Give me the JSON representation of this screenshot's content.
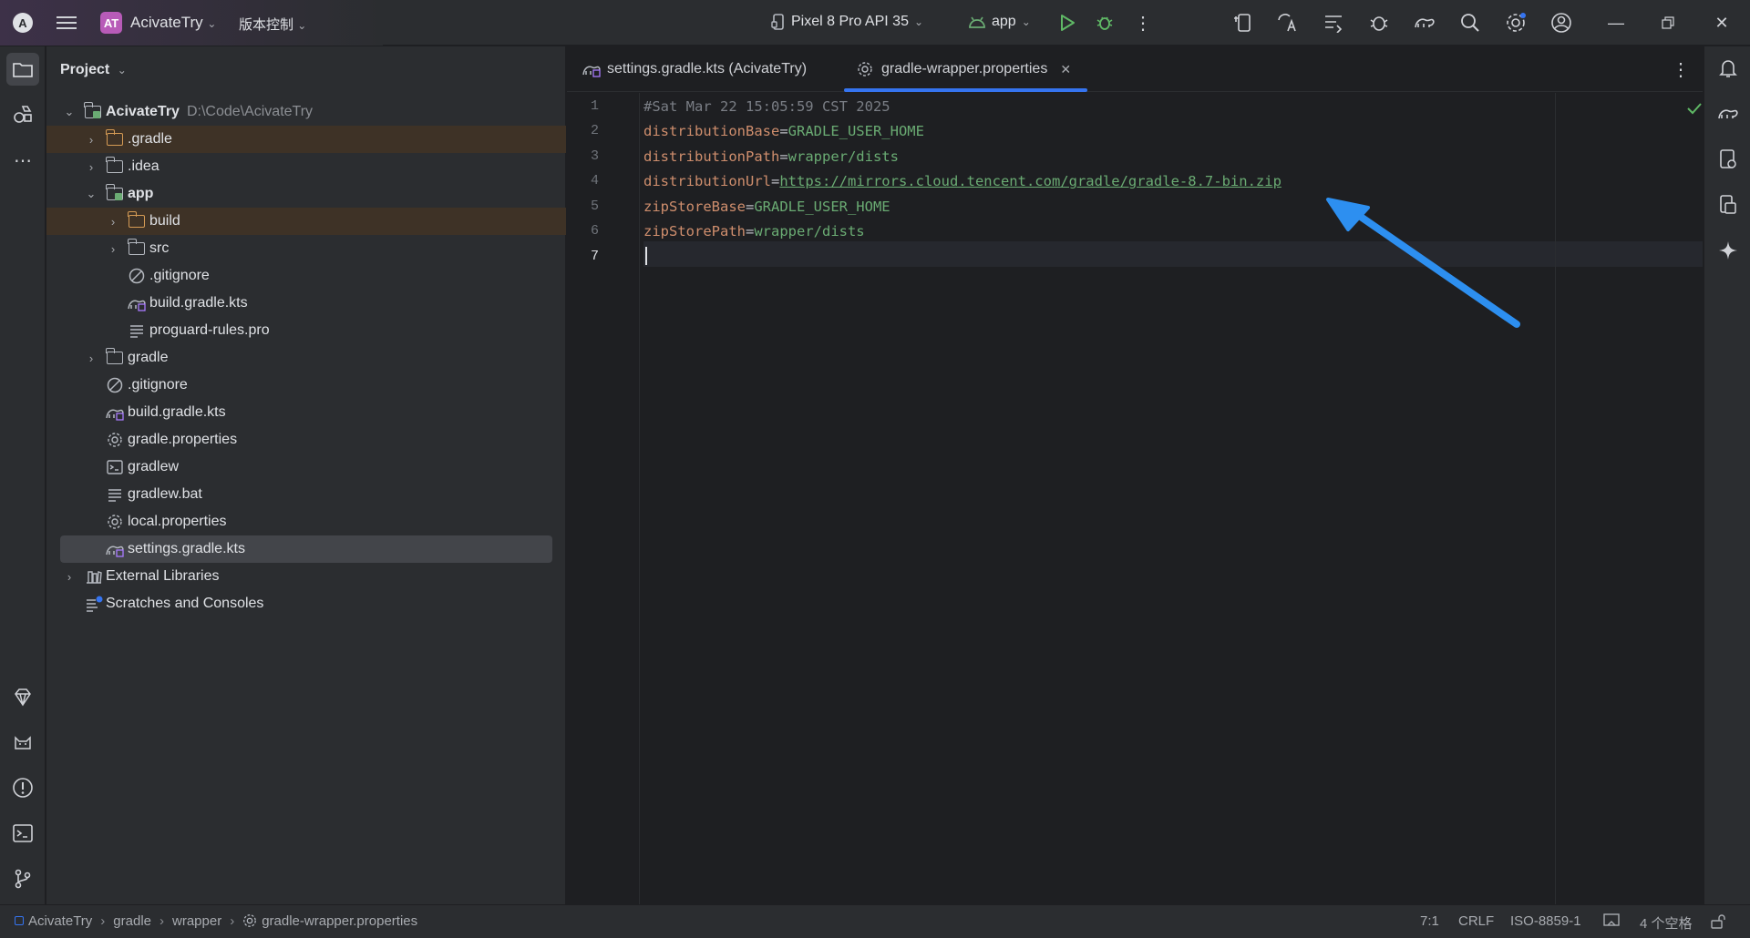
{
  "titlebar": {
    "project_badge": "AT",
    "project_name": "AcivateTry",
    "vcs_label": "版本控制",
    "device": "Pixel 8 Pro API 35",
    "run_config": "app",
    "icons": [
      "hamburger-icon",
      "run-icon",
      "debug-icon",
      "more-icon",
      "device-manager-icon",
      "translate-icon",
      "profiler-icon",
      "bug-icon",
      "gradle-sync-icon",
      "search-icon",
      "settings-icon",
      "account-icon"
    ]
  },
  "project_panel": {
    "title": "Project",
    "root_name": "AcivateTry",
    "root_path": "D:\\Code\\AcivateTry",
    "items": [
      {
        "label": ".gradle",
        "type": "folder",
        "excluded": true
      },
      {
        "label": ".idea",
        "type": "folder"
      },
      {
        "label": "app",
        "type": "module",
        "expanded": true
      },
      {
        "label": "build",
        "type": "folder",
        "excluded": true
      },
      {
        "label": "src",
        "type": "folder"
      },
      {
        "label": ".gitignore",
        "type": "ignore"
      },
      {
        "label": "build.gradle.kts",
        "type": "gradle"
      },
      {
        "label": "proguard-rules.pro",
        "type": "text"
      },
      {
        "label": "gradle",
        "type": "folder"
      },
      {
        "label": ".gitignore",
        "type": "ignore"
      },
      {
        "label": "build.gradle.kts",
        "type": "gradle"
      },
      {
        "label": "gradle.properties",
        "type": "properties"
      },
      {
        "label": "gradlew",
        "type": "shell"
      },
      {
        "label": "gradlew.bat",
        "type": "text"
      },
      {
        "label": "local.properties",
        "type": "properties"
      },
      {
        "label": "settings.gradle.kts",
        "type": "gradle",
        "selected": true
      },
      {
        "label": "External Libraries",
        "type": "library"
      },
      {
        "label": "Scratches and Consoles",
        "type": "scratch"
      }
    ]
  },
  "editor": {
    "tabs": [
      {
        "label": "settings.gradle.kts (AcivateTry)",
        "active": false
      },
      {
        "label": "gradle-wrapper.properties",
        "active": true
      }
    ],
    "lines": [
      {
        "num": "1",
        "comment": "#Sat Mar 22 15:05:59 CST 2025"
      },
      {
        "num": "2",
        "key": "distributionBase",
        "value": "GRADLE_USER_HOME"
      },
      {
        "num": "3",
        "key": "distributionPath",
        "value": "wrapper/dists"
      },
      {
        "num": "4",
        "key": "distributionUrl",
        "url": "https://mirrors.cloud.tencent.com/gradle/gradle-8.7-bin.zip"
      },
      {
        "num": "5",
        "key": "zipStoreBase",
        "value": "GRADLE_USER_HOME"
      },
      {
        "num": "6",
        "key": "zipStorePath",
        "value": "wrapper/dists"
      },
      {
        "num": "7"
      }
    ],
    "eq": "="
  },
  "statusbar": {
    "breadcrumb": [
      "AcivateTry",
      "gradle",
      "wrapper",
      "gradle-wrapper.properties"
    ],
    "position": "7:1",
    "line_ending": "CRLF",
    "encoding": "ISO-8859-1",
    "indent": "4 个空格"
  },
  "colors": {
    "accent": "#3574f0",
    "arrow": "#2d8ff0",
    "key": "#cf8e6d",
    "value": "#6aab73",
    "excluded_bg": "#3e3226"
  }
}
